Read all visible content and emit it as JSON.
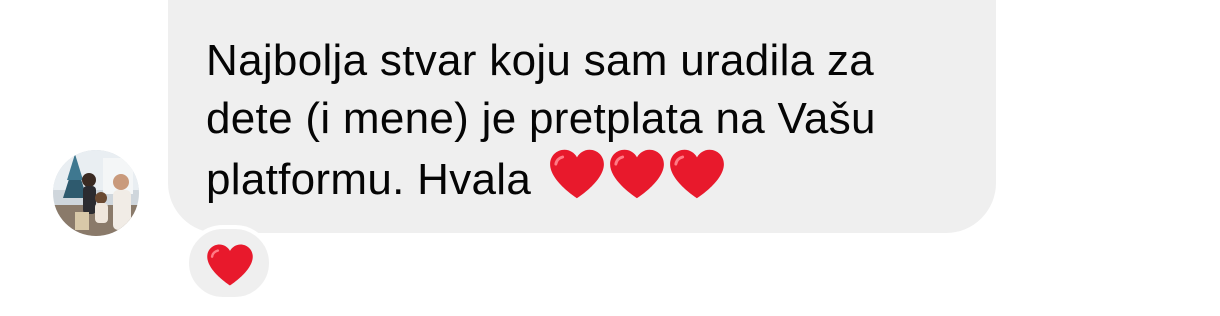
{
  "message": {
    "text_line1": "Najbolja stvar koju sam uradila za",
    "text_line2": "dete (i mene) je pretplata na Vašu",
    "text_line3": "platformu. Hvala",
    "inline_emoji": [
      "red-heart",
      "red-heart",
      "red-heart"
    ],
    "bubble_color": "#efefef",
    "text_color": "#050505"
  },
  "reaction": {
    "emoji": "red-heart",
    "color": "#e8192c"
  },
  "sender": {
    "avatar": "profile-photo"
  }
}
